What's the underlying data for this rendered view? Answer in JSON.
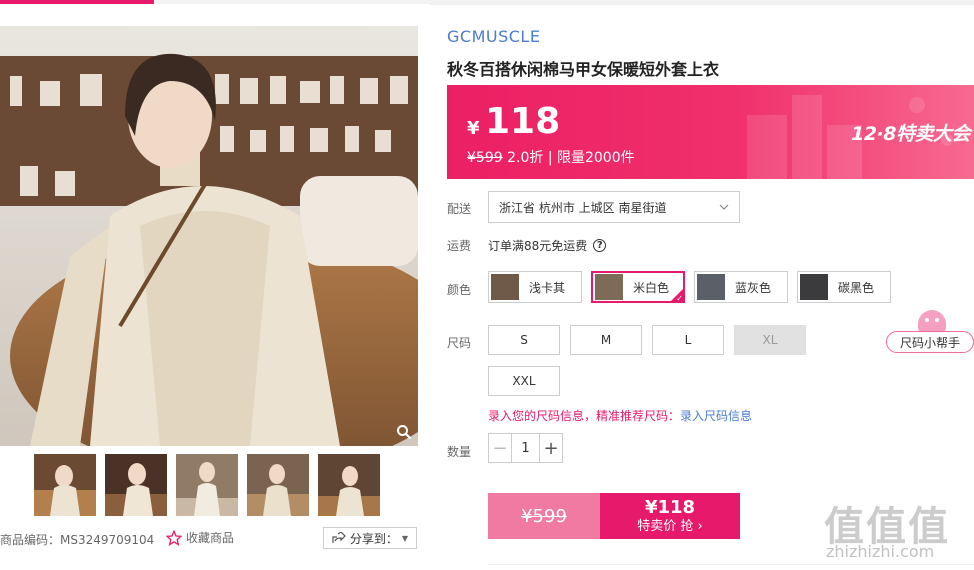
{
  "brand": "GCMUSCLE",
  "product_title": "秋冬百搭休闲棉马甲女保暖短外套上衣",
  "price": {
    "currency": "¥",
    "value": "118",
    "original": "¥599",
    "discount": "2.0折",
    "separator": "|",
    "limit": "限量2000件",
    "promo_banner": "12·8特卖大会"
  },
  "delivery": {
    "label": "配送",
    "address": "浙江省 杭州市 上城区 南星街道"
  },
  "shipping": {
    "label": "运费",
    "text": "订单满88元免运费",
    "help_icon": "?"
  },
  "color": {
    "label": "颜色",
    "options": [
      "浅卡其",
      "米白色",
      "蓝灰色",
      "碳黑色"
    ],
    "selected": "米白色"
  },
  "size": {
    "label": "尺码",
    "options": [
      "S",
      "M",
      "L",
      "XL",
      "XXL"
    ],
    "disabled": [
      "XL"
    ],
    "helper": "尺码小帮手",
    "tip_part1": "录入您的尺码信息，",
    "tip_part2": "精准推荐尺码：",
    "tip_link": "录入尺码信息"
  },
  "quantity": {
    "label": "数量",
    "value": "1",
    "minus": "−",
    "plus": "+"
  },
  "buy": {
    "old_price": "¥599",
    "new_price": "¥118",
    "action": "特卖价 抢 ›"
  },
  "footer": {
    "code": "商品编码：MS3249709104",
    "favorite": "收藏商品",
    "share": "分享到："
  },
  "watermark": {
    "logo": "值值值",
    "site": "zhizhizhi.com"
  },
  "colors": {
    "accent": "#e6196b",
    "link": "#4a7ccf"
  }
}
